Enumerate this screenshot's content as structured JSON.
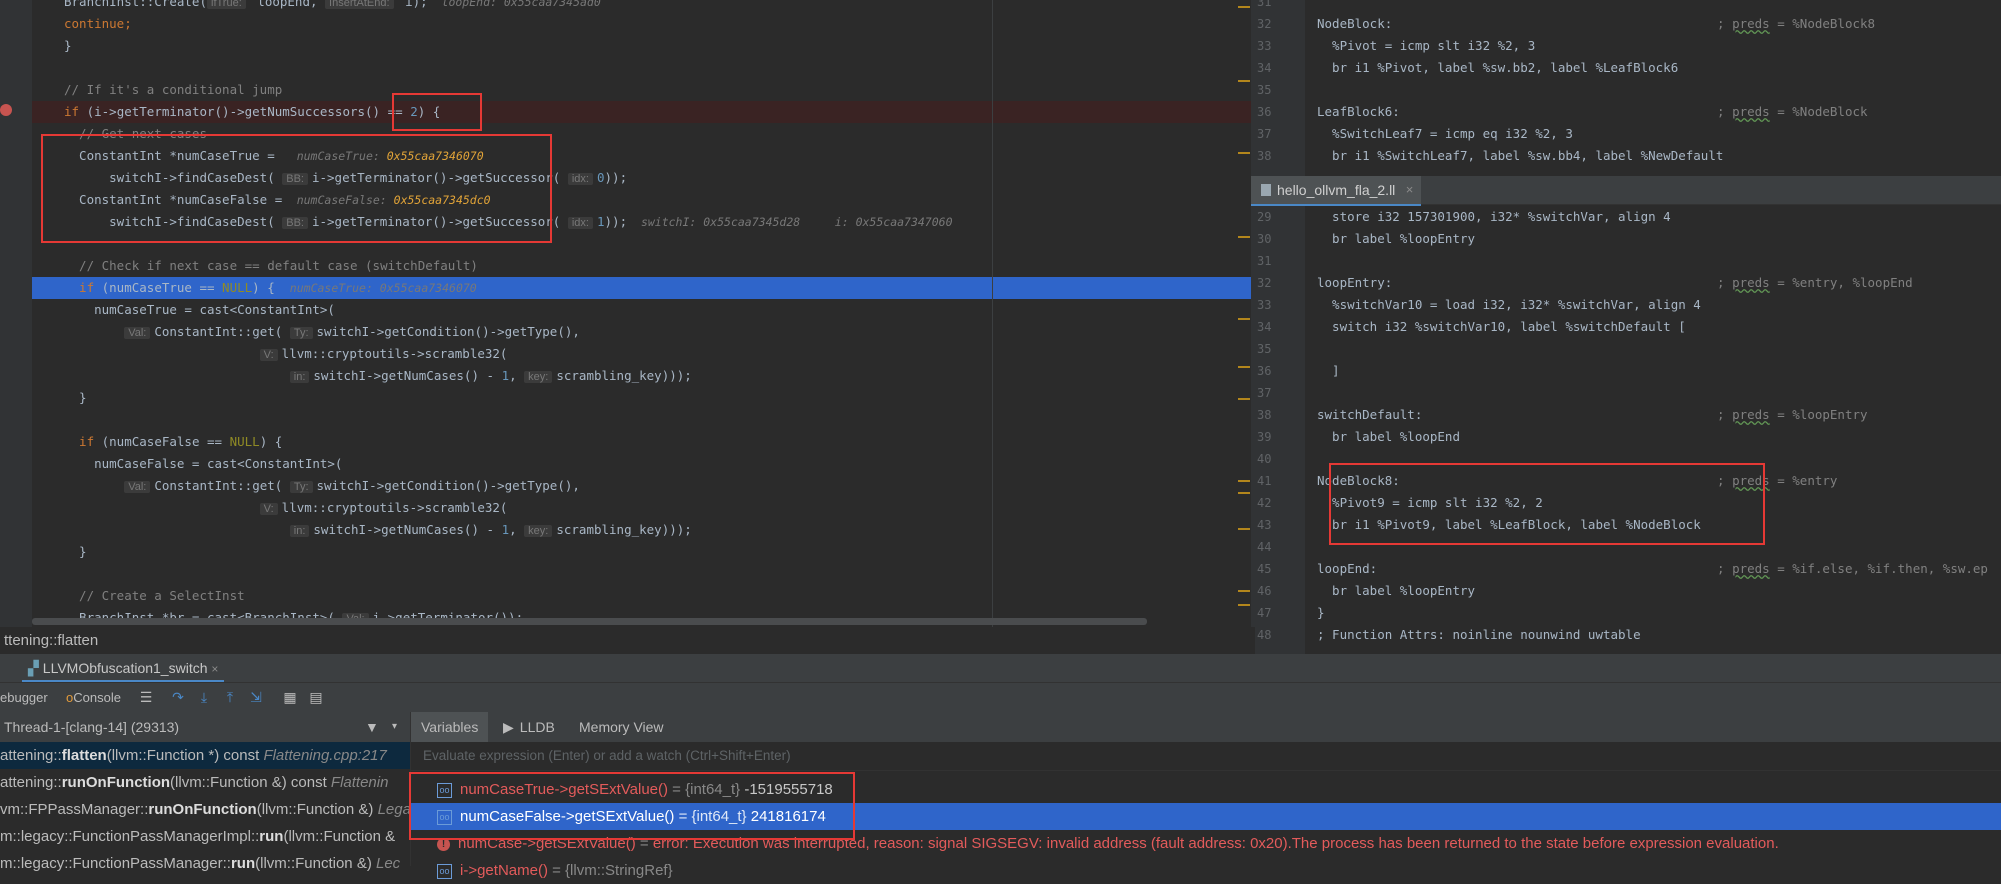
{
  "left_code": {
    "lines": [
      {
        "parts": [
          {
            "t": "BranchInst::Create(",
            "c": ""
          },
          {
            "t": "ifTrue:",
            "c": "hint"
          },
          {
            "t": " loopEnd, ",
            "c": ""
          },
          {
            "t": "InsertAtEnd:",
            "c": "hint"
          },
          {
            "t": " i);",
            "c": ""
          },
          {
            "t": "  loopEnd: 0x55caa7345ad0",
            "c": "iv"
          }
        ]
      },
      {
        "parts": [
          {
            "t": "continue;",
            "c": "kw"
          }
        ]
      },
      {
        "parts": [
          {
            "t": "}",
            "c": ""
          }
        ]
      },
      {
        "parts": [
          {
            "t": "",
            "c": ""
          }
        ]
      },
      {
        "parts": [
          {
            "t": "// If it's a conditional jump",
            "c": "cm"
          }
        ]
      },
      {
        "parts": [
          {
            "t": "if",
            "c": "kw"
          },
          {
            "t": " (i->getTerminator()->getNumSuccessors() == ",
            "c": ""
          },
          {
            "t": "2",
            "c": "num"
          },
          {
            "t": ") {",
            "c": ""
          }
        ]
      },
      {
        "parts": [
          {
            "t": "  // Get next cases",
            "c": "cm"
          }
        ]
      },
      {
        "parts": [
          {
            "t": "  ConstantInt *numCaseTrue =  ",
            "c": ""
          },
          {
            "t": " numCaseTrue: ",
            "c": "iv"
          },
          {
            "t": "0x55caa7346070",
            "c": "hex"
          }
        ]
      },
      {
        "parts": [
          {
            "t": "      switchI->findCaseDest( ",
            "c": ""
          },
          {
            "t": "BB:",
            "c": "hint"
          },
          {
            "t": "i->getTerminator()->getSuccessor( ",
            "c": ""
          },
          {
            "t": "idx:",
            "c": "hint"
          },
          {
            "t": "0",
            "c": "num"
          },
          {
            "t": "));",
            "c": ""
          }
        ]
      },
      {
        "parts": [
          {
            "t": "  ConstantInt *numCaseFalse = ",
            "c": ""
          },
          {
            "t": " numCaseFalse: ",
            "c": "iv"
          },
          {
            "t": "0x55caa7345dc0",
            "c": "hex"
          }
        ]
      },
      {
        "parts": [
          {
            "t": "      switchI->findCaseDest( ",
            "c": ""
          },
          {
            "t": "BB:",
            "c": "hint"
          },
          {
            "t": "i->getTerminator()->getSuccessor( ",
            "c": ""
          },
          {
            "t": "idx:",
            "c": "hint"
          },
          {
            "t": "1",
            "c": "num"
          },
          {
            "t": "));",
            "c": ""
          },
          {
            "t": "  switchI: 0x55caa7345d28     i: 0x55caa7347060",
            "c": "iv"
          }
        ]
      },
      {
        "parts": [
          {
            "t": "",
            "c": ""
          }
        ]
      },
      {
        "parts": [
          {
            "t": "  // Check if next case == default case (switchDefault)",
            "c": "cm"
          }
        ]
      },
      {
        "parts": [
          {
            "t": "  if",
            "c": "kw"
          },
          {
            "t": " (numCaseTrue == ",
            "c": ""
          },
          {
            "t": "NULL",
            "c": "mac"
          },
          {
            "t": ") {  ",
            "c": ""
          },
          {
            "t": "numCaseTrue: 0x55caa7346070",
            "c": "iv"
          }
        ]
      },
      {
        "parts": [
          {
            "t": "    numCaseTrue = cast<ConstantInt>(",
            "c": ""
          }
        ]
      },
      {
        "parts": [
          {
            "t": "        ",
            "c": ""
          },
          {
            "t": "Val:",
            "c": "hint"
          },
          {
            "t": "ConstantInt::get( ",
            "c": ""
          },
          {
            "t": "Ty:",
            "c": "hint"
          },
          {
            "t": "switchI->getCondition()->getType(),",
            "c": ""
          }
        ]
      },
      {
        "parts": [
          {
            "t": "                          ",
            "c": ""
          },
          {
            "t": "V:",
            "c": "hint"
          },
          {
            "t": "llvm::cryptoutils->scramble32(",
            "c": ""
          }
        ]
      },
      {
        "parts": [
          {
            "t": "                              ",
            "c": ""
          },
          {
            "t": "in:",
            "c": "hint"
          },
          {
            "t": "switchI->getNumCases() - ",
            "c": ""
          },
          {
            "t": "1",
            "c": "num"
          },
          {
            "t": ", ",
            "c": ""
          },
          {
            "t": "key:",
            "c": "hint"
          },
          {
            "t": "scrambling_key)));",
            "c": ""
          }
        ]
      },
      {
        "parts": [
          {
            "t": "  }",
            "c": ""
          }
        ]
      },
      {
        "parts": [
          {
            "t": "",
            "c": ""
          }
        ]
      },
      {
        "parts": [
          {
            "t": "  if",
            "c": "kw"
          },
          {
            "t": " (numCaseFalse == ",
            "c": ""
          },
          {
            "t": "NULL",
            "c": "mac"
          },
          {
            "t": ") {",
            "c": ""
          }
        ]
      },
      {
        "parts": [
          {
            "t": "    numCaseFalse = cast<ConstantInt>(",
            "c": ""
          }
        ]
      },
      {
        "parts": [
          {
            "t": "        ",
            "c": ""
          },
          {
            "t": "Val:",
            "c": "hint"
          },
          {
            "t": "ConstantInt::get( ",
            "c": ""
          },
          {
            "t": "Ty:",
            "c": "hint"
          },
          {
            "t": "switchI->getCondition()->getType(),",
            "c": ""
          }
        ]
      },
      {
        "parts": [
          {
            "t": "                          ",
            "c": ""
          },
          {
            "t": "V:",
            "c": "hint"
          },
          {
            "t": "llvm::cryptoutils->scramble32(",
            "c": ""
          }
        ]
      },
      {
        "parts": [
          {
            "t": "                              ",
            "c": ""
          },
          {
            "t": "in:",
            "c": "hint"
          },
          {
            "t": "switchI->getNumCases() - ",
            "c": ""
          },
          {
            "t": "1",
            "c": "num"
          },
          {
            "t": ", ",
            "c": ""
          },
          {
            "t": "key:",
            "c": "hint"
          },
          {
            "t": "scrambling_key)));",
            "c": ""
          }
        ]
      },
      {
        "parts": [
          {
            "t": "  }",
            "c": ""
          }
        ]
      },
      {
        "parts": [
          {
            "t": "",
            "c": ""
          }
        ]
      },
      {
        "parts": [
          {
            "t": "  // Create a SelectInst",
            "c": "cm"
          }
        ]
      },
      {
        "parts": [
          {
            "t": "  BranchInst *br = cast<BranchInst>( ",
            "c": ""
          },
          {
            "t": "Val:",
            "c": "hint"
          },
          {
            "t": "i->getTerminator());",
            "c": ""
          }
        ]
      }
    ]
  },
  "right_top": {
    "line_numbers": [
      "31",
      "32",
      "33",
      "34",
      "35",
      "36",
      "37",
      "38"
    ],
    "lines": [
      {
        "code": "",
        "comment": ""
      },
      {
        "code": "NodeBlock:",
        "comment": "; preds = %NodeBlock8"
      },
      {
        "code": "  %Pivot = icmp slt i32 %2, 3",
        "comment": ""
      },
      {
        "code": "  br i1 %Pivot, label %sw.bb2, label %LeafBlock6",
        "comment": ""
      },
      {
        "code": "",
        "comment": ""
      },
      {
        "code": "LeafBlock6:",
        "comment": "; preds = %NodeBlock"
      },
      {
        "code": "  %SwitchLeaf7 = icmp eq i32 %2, 3",
        "comment": ""
      },
      {
        "code": "  br i1 %SwitchLeaf7, label %sw.bb4, label %NewDefault",
        "comment": ""
      }
    ]
  },
  "right_tab": {
    "label": "hello_ollvm_fla_2.ll",
    "close": "×"
  },
  "right_bottom": {
    "line_numbers": [
      "29",
      "30",
      "31",
      "32",
      "33",
      "34",
      "35",
      "36",
      "37",
      "38",
      "39",
      "40",
      "41",
      "42",
      "43",
      "44",
      "45",
      "46",
      "47",
      "48"
    ],
    "lines": [
      {
        "code": "  store i32 157301900, i32* %switchVar, align 4",
        "comment": ""
      },
      {
        "code": "  br label %loopEntry",
        "comment": ""
      },
      {
        "code": "",
        "comment": ""
      },
      {
        "code": "loopEntry:",
        "comment": "; preds = %entry, %loopEnd"
      },
      {
        "code": "  %switchVar10 = load i32, i32* %switchVar, align 4",
        "comment": ""
      },
      {
        "code": "  switch i32 %switchVar10, label %switchDefault [",
        "comment": ""
      },
      {
        "code": "",
        "comment": ""
      },
      {
        "code": "  ]",
        "comment": ""
      },
      {
        "code": "",
        "comment": ""
      },
      {
        "code": "switchDefault:",
        "comment": "; preds = %loopEntry"
      },
      {
        "code": "  br label %loopEnd",
        "comment": ""
      },
      {
        "code": "",
        "comment": ""
      },
      {
        "code": "NodeBlock8:",
        "comment": "; preds = %entry"
      },
      {
        "code": "  %Pivot9 = icmp slt i32 %2, 2",
        "comment": ""
      },
      {
        "code": "  br i1 %Pivot9, label %LeafBlock, label %NodeBlock",
        "comment": ""
      },
      {
        "code": "",
        "comment": ""
      },
      {
        "code": "loopEnd:",
        "comment": "; preds = %if.else, %if.then, %sw.ep"
      },
      {
        "code": "  br label %loopEntry",
        "comment": ""
      },
      {
        "code": "}",
        "comment": ""
      },
      {
        "code": "; Function Attrs: noinline nounwind uwtable",
        "comment": ""
      }
    ]
  },
  "breadcrumb": "ttening::flatten",
  "debug_session_tab": "LLVMObfuscation1_switch",
  "toolbar": {
    "debugger": "ebugger",
    "console": "Console"
  },
  "thread": "Thread-1-[clang-14] (29313)",
  "frames": [
    {
      "pre": "attening::",
      "bold": "flatten",
      "post": "(llvm::Function *) const ",
      "italic": "Flattening.cpp:217"
    },
    {
      "pre": "attening::",
      "bold": "runOnFunction",
      "post": "(llvm::Function &) const ",
      "italic": "Flattenin"
    },
    {
      "pre": "vm::FPPassManager::",
      "bold": "runOnFunction",
      "post": "(llvm::Function &) ",
      "italic": "Lega"
    },
    {
      "pre": "m::legacy::FunctionPassManagerImpl::",
      "bold": "run",
      "post": "(llvm::Function &",
      "italic": ""
    },
    {
      "pre": "m::legacy::FunctionPassManager::",
      "bold": "run",
      "post": "(llvm::Function &) ",
      "italic": "Lec"
    }
  ],
  "vars_tabs": {
    "variables": "Variables",
    "lldb": "LLDB",
    "memory": "Memory View"
  },
  "eval_placeholder": "Evaluate expression (Enter) or add a watch (Ctrl+Shift+Enter)",
  "watches": [
    {
      "name": "numCaseTrue->getSExtValue()",
      "type": " = {int64_t} ",
      "value": "-1519555718",
      "error": false
    },
    {
      "name": "numCaseFalse->getSExtValue()",
      "type": " = {int64_t} ",
      "value": "241816174",
      "error": false
    },
    {
      "name": "numCase->getSExtValue()",
      "type": " = ",
      "value": "error: Execution was interrupted, reason: signal SIGSEGV: invalid address (fault address: 0x20).The process has been returned to the state before expression evaluation.",
      "error": true
    },
    {
      "name": "i->getName()",
      "type": " = {llvm::StringRef}",
      "value": "",
      "error": false
    }
  ]
}
